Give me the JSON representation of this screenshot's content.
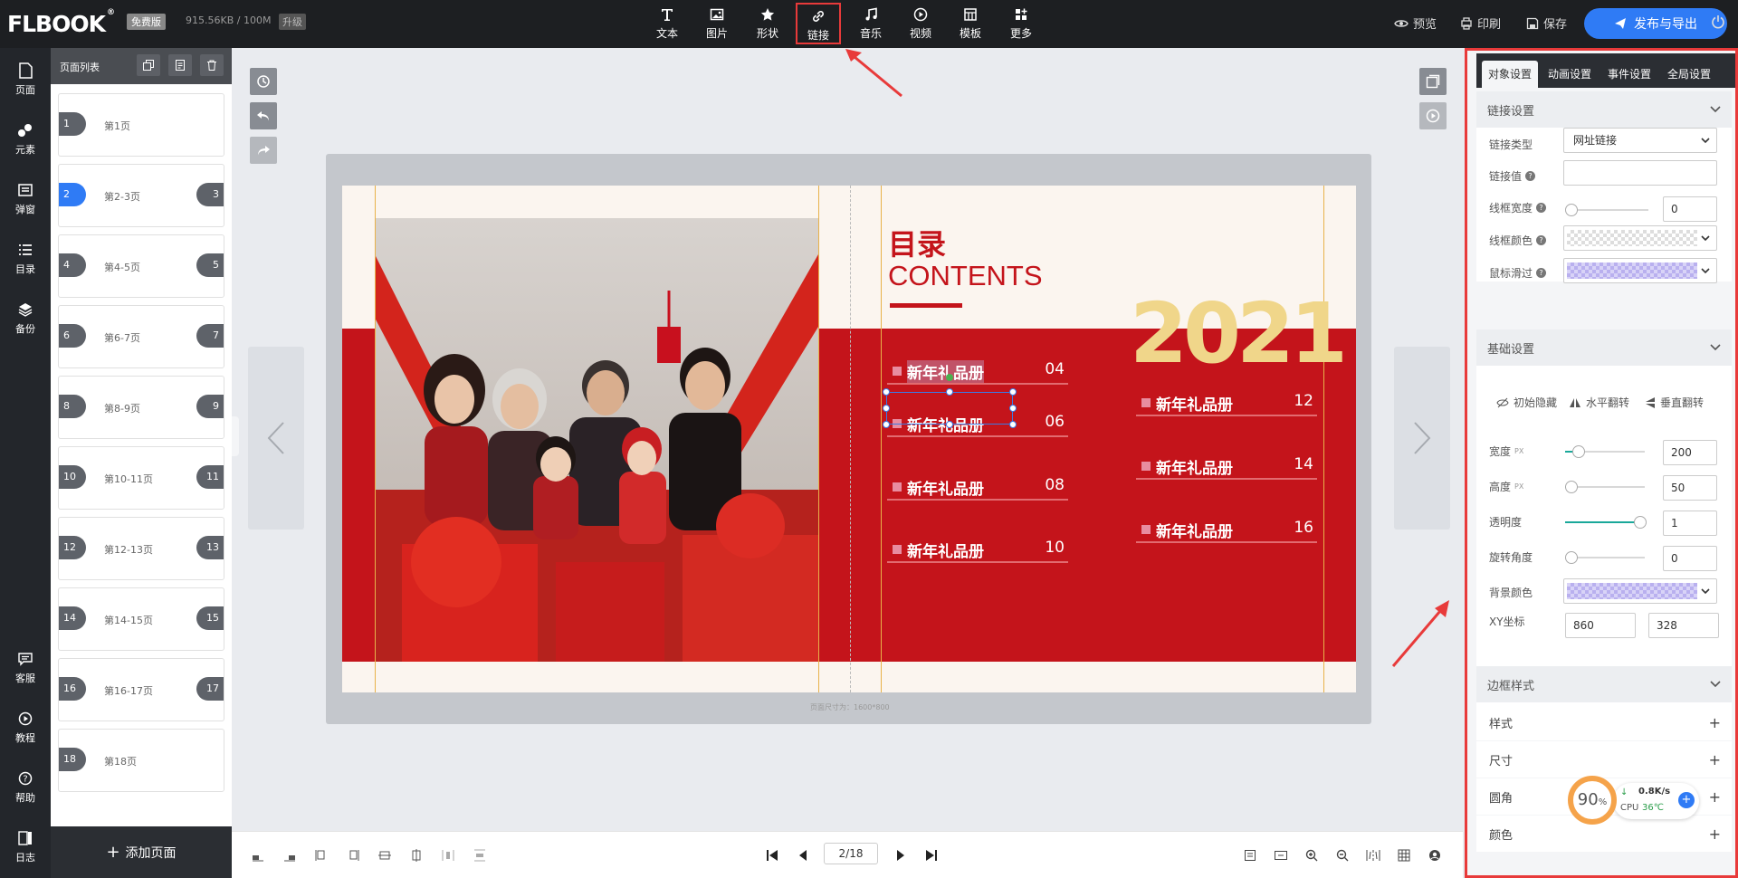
{
  "topbar": {
    "logo": "FLBOOK",
    "plan_badge": "免费版",
    "storage": "915.56KB / 100M",
    "upgrade": "升级",
    "tools": [
      {
        "label": "文本",
        "icon": "text-icon"
      },
      {
        "label": "图片",
        "icon": "image-icon"
      },
      {
        "label": "形状",
        "icon": "star-icon"
      },
      {
        "label": "链接",
        "icon": "link-icon"
      },
      {
        "label": "音乐",
        "icon": "music-icon"
      },
      {
        "label": "视频",
        "icon": "play-icon"
      },
      {
        "label": "模板",
        "icon": "template-icon"
      },
      {
        "label": "更多",
        "icon": "more-icon"
      }
    ],
    "preview": "预览",
    "print": "印刷",
    "save": "保存",
    "publish": "发布与导出"
  },
  "leftnav": [
    {
      "label": "页面",
      "icon": "page-icon"
    },
    {
      "label": "元素",
      "icon": "elements-icon"
    },
    {
      "label": "弹窗",
      "icon": "popup-icon"
    },
    {
      "label": "目录",
      "icon": "list-icon"
    },
    {
      "label": "备份",
      "icon": "layers-icon"
    },
    {
      "label": "客服",
      "icon": "chat-icon"
    },
    {
      "label": "教程",
      "icon": "play-circle-icon"
    },
    {
      "label": "帮助",
      "icon": "help-icon"
    },
    {
      "label": "日志",
      "icon": "log-icon"
    }
  ],
  "pages": {
    "title": "页面列表",
    "items": [
      {
        "label": "第1页",
        "left": "1",
        "right": ""
      },
      {
        "label": "第2-3页",
        "left": "2",
        "right": "3"
      },
      {
        "label": "第4-5页",
        "left": "4",
        "right": "5"
      },
      {
        "label": "第6-7页",
        "left": "6",
        "right": "7"
      },
      {
        "label": "第8-9页",
        "left": "8",
        "right": "9"
      },
      {
        "label": "第10-11页",
        "left": "10",
        "right": "11"
      },
      {
        "label": "第12-13页",
        "left": "12",
        "right": "13"
      },
      {
        "label": "第14-15页",
        "left": "14",
        "right": "15"
      },
      {
        "label": "第16-17页",
        "left": "16",
        "right": "17"
      },
      {
        "label": "第18页",
        "left": "18",
        "right": ""
      }
    ],
    "add": "添加页面"
  },
  "canvas": {
    "page_size_note": "页面尺寸为：1600*800",
    "toc_title": "目录",
    "toc_sub": "CONTENTS",
    "year": "2021",
    "toc_items": [
      {
        "text": "新年礼品册",
        "page": "04"
      },
      {
        "text": "新年礼品册",
        "page": "06"
      },
      {
        "text": "新年礼品册",
        "page": "08"
      },
      {
        "text": "新年礼品册",
        "page": "10"
      },
      {
        "text": "新年礼品册",
        "page": "12"
      },
      {
        "text": "新年礼品册",
        "page": "14"
      },
      {
        "text": "新年礼品册",
        "page": "16"
      }
    ]
  },
  "bottombar": {
    "page_indicator": "2/18"
  },
  "rightpanel": {
    "tabs": [
      "对象设置",
      "动画设置",
      "事件设置",
      "全局设置"
    ],
    "link_section": "链接设置",
    "link_type_label": "链接类型",
    "link_type_value": "网址链接",
    "link_value_label": "链接值",
    "link_value": "",
    "border_width_label": "线框宽度",
    "border_width_value": "0",
    "border_color_label": "线框颜色",
    "hover_label": "鼠标滑过",
    "basic_section": "基础设置",
    "init_hidden": "初始隐藏",
    "flip_h": "水平翻转",
    "flip_v": "垂直翻转",
    "width_label": "宽度",
    "width_unit": "PX",
    "width_value": "200",
    "height_label": "高度",
    "height_unit": "PX",
    "height_value": "50",
    "opacity_label": "透明度",
    "opacity_value": "1",
    "rotation_label": "旋转角度",
    "rotation_value": "0",
    "bg_color_label": "背景颜色",
    "xy_label": "XY坐标",
    "x_value": "860",
    "y_value": "328",
    "border_style_section": "边框样式",
    "border_rows": [
      "样式",
      "尺寸",
      "圆角",
      "颜色"
    ]
  },
  "cpu_widget": {
    "percent": "90",
    "unit": "%",
    "speed": "0.8K/s",
    "cpu_label": "CPU",
    "temp": "36℃"
  },
  "colors": {
    "accent_blue": "#2f7bf5",
    "highlight_red": "#e83a3a",
    "book_red": "#c4141b",
    "year_gold": "#f0d68a"
  }
}
